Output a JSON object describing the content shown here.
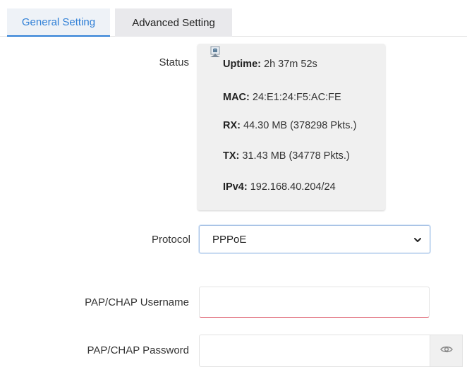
{
  "tabs": [
    {
      "label": "General Setting",
      "active": true
    },
    {
      "label": "Advanced Setting",
      "active": false
    }
  ],
  "status": {
    "label": "Status",
    "icon": "network-port-icon",
    "lines": [
      {
        "key": "Uptime:",
        "value": " 2h 37m 52s"
      },
      {
        "key": "MAC:",
        "value": " 24:E1:24:F5:AC:FE"
      },
      {
        "key": "RX:",
        "value": " 44.30 MB (378298 Pkts.)"
      },
      {
        "key": "TX:",
        "value": " 31.43 MB (34778 Pkts.)"
      },
      {
        "key": "IPv4:",
        "value": " 192.168.40.204/24"
      }
    ]
  },
  "protocol": {
    "label": "Protocol",
    "selected": "PPPoE"
  },
  "username": {
    "label": "PAP/CHAP Username",
    "value": ""
  },
  "password": {
    "label": "PAP/CHAP Password",
    "value": ""
  },
  "colors": {
    "accent": "#2f7fd6",
    "invalid": "#d94b5c"
  }
}
